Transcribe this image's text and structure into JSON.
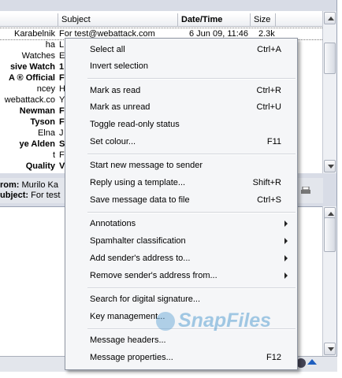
{
  "columns": {
    "subject": "Subject",
    "date_time": "Date/Time",
    "size": "Size"
  },
  "messages": [
    {
      "from": "Karabelnik",
      "subject": "For test@webattack.com",
      "date": "6 Jun 09, 11:46",
      "size": "2.3k"
    },
    {
      "from": "ha",
      "subject": "L",
      "date": "",
      "size": ""
    },
    {
      "from": "Watches",
      "subject": "E",
      "date": "",
      "size": ""
    },
    {
      "from": "sive Watch",
      "subject": "1",
      "date": "",
      "size": ""
    },
    {
      "from": "A ® Official",
      "subject": "F",
      "date": "",
      "size": ""
    },
    {
      "from": "ncey",
      "subject": "H",
      "date": "",
      "size": ""
    },
    {
      "from": "webattack.co",
      "subject": "Y",
      "date": "",
      "size": ""
    },
    {
      "from": "Newman",
      "subject": "F",
      "date": "",
      "size": ""
    },
    {
      "from": "Tyson",
      "subject": "F",
      "date": "",
      "size": ""
    },
    {
      "from": "Elna",
      "subject": "J",
      "date": "",
      "size": ""
    },
    {
      "from": "ye Alden",
      "subject": "S",
      "date": "",
      "size": ""
    },
    {
      "from": "t",
      "subject": "F",
      "date": "",
      "size": ""
    },
    {
      "from": "Quality",
      "subject": "V",
      "date": "",
      "size": ""
    }
  ],
  "preview_header": {
    "from_label": "rom:",
    "from_value": "Murilo Ka",
    "subject_label": "ubject:",
    "subject_value": "For test"
  },
  "menu": {
    "group1": [
      {
        "label": "Select all",
        "key": "Ctrl+A"
      },
      {
        "label": "Invert selection",
        "key": ""
      }
    ],
    "group2": [
      {
        "label": "Mark as read",
        "key": "Ctrl+R"
      },
      {
        "label": "Mark as unread",
        "key": "Ctrl+U"
      },
      {
        "label": "Toggle read-only status",
        "key": ""
      },
      {
        "label": "Set colour...",
        "key": "F11"
      }
    ],
    "group3": [
      {
        "label": "Start new message to sender",
        "key": ""
      },
      {
        "label": "Reply using a template...",
        "key": "Shift+R"
      },
      {
        "label": "Save message data to file",
        "key": "Ctrl+S"
      }
    ],
    "group4": [
      {
        "label": "Annotations",
        "key": ""
      },
      {
        "label": "Spamhalter classification",
        "key": ""
      },
      {
        "label": "Add sender's address to...",
        "key": ""
      },
      {
        "label": "Remove sender's address from...",
        "key": ""
      }
    ],
    "group5": [
      {
        "label": "Search for digital signature...",
        "key": ""
      },
      {
        "label": "Key management...",
        "key": ""
      }
    ],
    "group6": [
      {
        "label": "Message headers...",
        "key": ""
      },
      {
        "label": "Message properties...",
        "key": "F12"
      }
    ]
  },
  "watermark": "SnapFiles",
  "colors": {
    "menu_bg": "#f5f6f8",
    "app_bg": "#d8dce6",
    "accent": "#1f5fbf"
  }
}
